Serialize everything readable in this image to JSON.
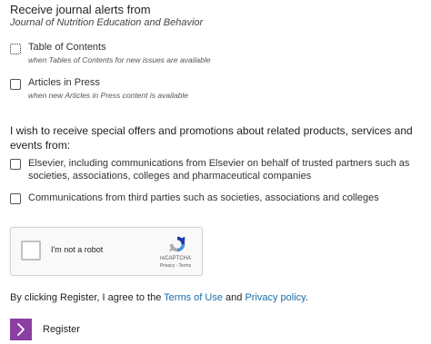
{
  "header": {
    "title": "Receive journal alerts from",
    "journal": "Journal of Nutrition Education and Behavior"
  },
  "alerts": [
    {
      "label": "Table of Contents",
      "sub": "when Tables of Contents for new issues are available"
    },
    {
      "label": "Articles in Press",
      "sub": "when new Articles in Press content is available"
    }
  ],
  "offers": {
    "intro": "I wish to receive special offers and promotions about related products, services and events from:",
    "elsevier": "Elsevier, including communications from Elsevier on behalf of trusted partners such as societies, associations, colleges and pharmaceutical companies",
    "third_parties": "Communications from third parties such as societies, associations and colleges"
  },
  "recaptcha": {
    "label": "I'm not a robot",
    "brand": "reCAPTCHA",
    "terms": "Privacy - Terms"
  },
  "agreement": {
    "prefix": "By clicking Register, I agree to the ",
    "terms_link": "Terms of Use",
    "middle": " and ",
    "privacy_link": "Privacy policy",
    "suffix": "."
  },
  "register": {
    "label": "Register"
  },
  "colors": {
    "accent": "#8b3ea3",
    "link": "#1a6ea8"
  }
}
